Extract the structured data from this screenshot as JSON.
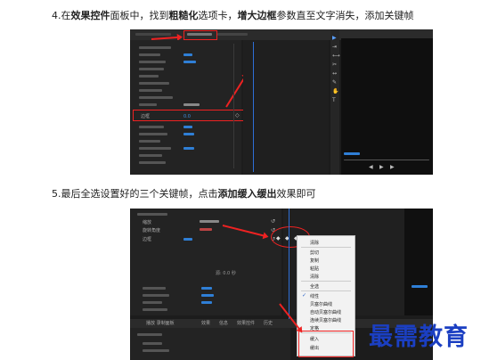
{
  "steps": [
    {
      "prefix": "4.在",
      "b1": "效果控件",
      "t1": "面板中，找到",
      "b2": "粗糙化",
      "t2": "选项卡，",
      "b3": "增大边框",
      "t3": "参数直至文字消失，添加关键帧"
    },
    {
      "t0": "5.最后全选设置好的三个关键帧，点击",
      "b1": "添加缓入缓出",
      "t1": "效果即可"
    }
  ],
  "screenshot1": {
    "property_label": "边框",
    "property_value": "0.0"
  },
  "screenshot2": {
    "rows": [
      "缩放",
      "旋转角度",
      "边框"
    ],
    "timeline_label": "源: 0.0 秒",
    "bottom_tabs": [
      "播放 录制面板",
      "效果",
      "信息",
      "效果控件",
      "历史"
    ],
    "context_menu": [
      "清除",
      "剪切",
      "复制",
      "粘贴",
      "清除",
      "全选",
      "线性",
      "贝塞尔曲线",
      "自动贝塞尔曲线",
      "连续贝塞尔曲线",
      "定格",
      "缓入",
      "缓出"
    ]
  },
  "watermark": "最需教育",
  "colors": {
    "highlight": "#e22222",
    "watermark": "#1b3fc2",
    "panel_bg": "#1c1c1c"
  }
}
